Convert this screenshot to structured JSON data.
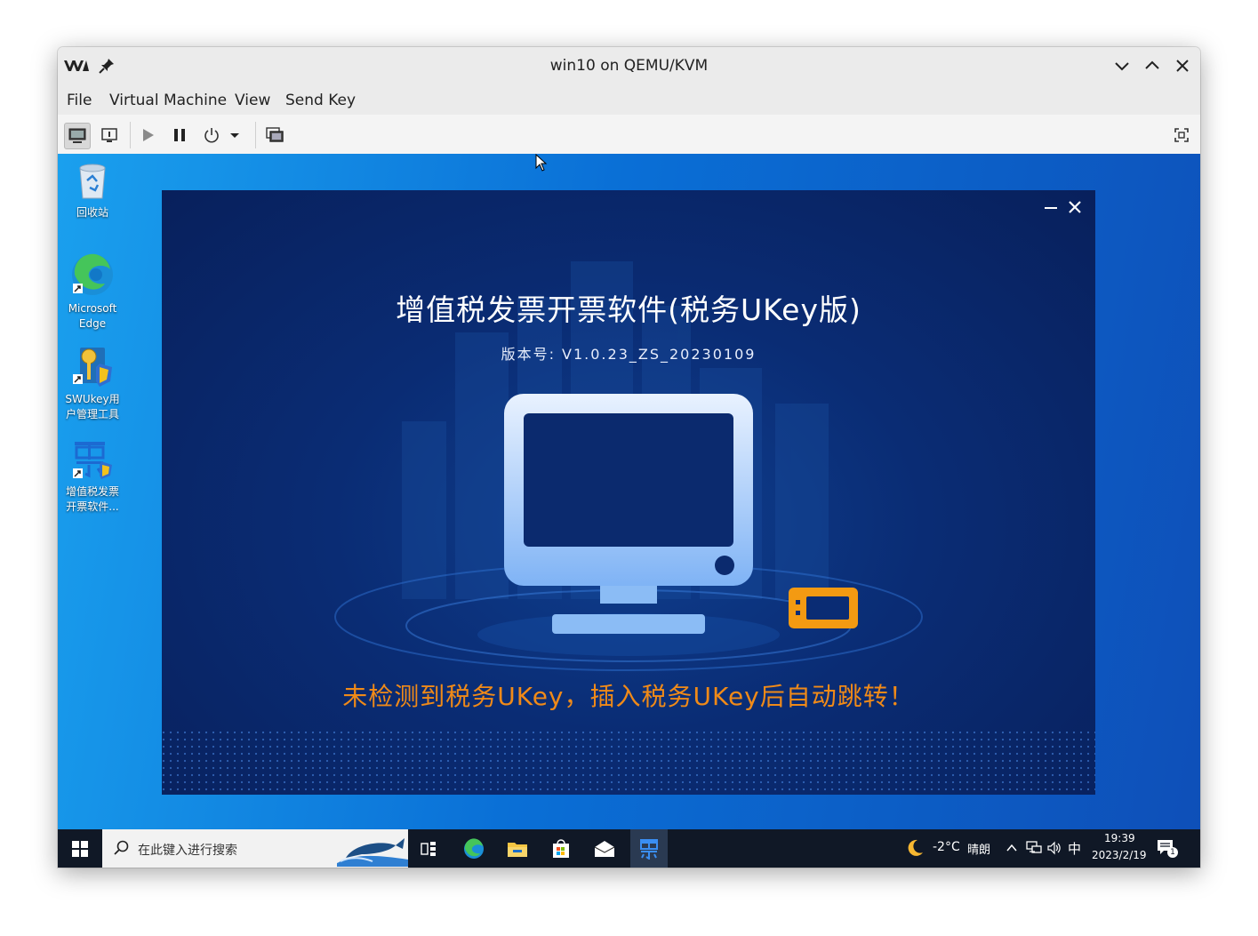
{
  "window": {
    "title": "win10 on QEMU/KVM"
  },
  "menu": [
    "File",
    "Virtual Machine",
    "View",
    "Send Key"
  ],
  "desktop": {
    "icons": [
      {
        "label_line1": "回收站",
        "label_line2": ""
      },
      {
        "label_line1": "Microsoft",
        "label_line2": "Edge"
      },
      {
        "label_line1": "SWUkey用",
        "label_line2": "户管理工具"
      },
      {
        "label_line1": "增值税发票",
        "label_line2": "开票软件..."
      }
    ]
  },
  "app": {
    "title": "增值税发票开票软件(税务UKey版)",
    "version": "版本号:  V1.0.23_ZS_20230109",
    "message": "未检测到税务UKey，插入税务UKey后自动跳转！"
  },
  "taskbar": {
    "search_placeholder": "在此键入进行搜索",
    "weather_temp": "-2°C",
    "weather_text": "晴朗",
    "ime": "中",
    "time": "19:39",
    "date": "2023/2/19",
    "notification_count": "1"
  },
  "colors": {
    "desktop_blue": "#0a6fd6",
    "app_bg": "#0a2c74",
    "warning_orange": "#f08a18",
    "taskbar": "#101826"
  }
}
